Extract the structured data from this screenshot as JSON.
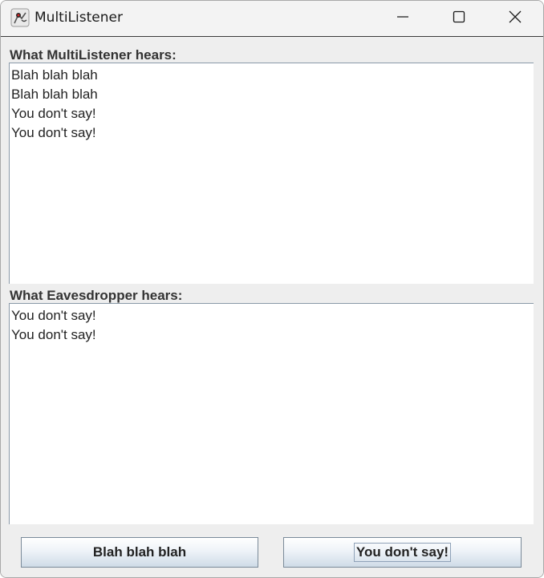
{
  "window": {
    "title": "MultiListener",
    "icon": "java-duke-icon"
  },
  "titlebar_controls": {
    "minimize": "minimize-icon",
    "maximize": "maximize-icon",
    "close": "close-icon"
  },
  "multilistener": {
    "label": "What MultiListener hears:",
    "lines": [
      "Blah blah blah",
      "Blah blah blah",
      "You don't say!",
      "You don't say!"
    ]
  },
  "eavesdropper": {
    "label": "What Eavesdropper hears:",
    "lines": [
      "You don't say!",
      "You don't say!"
    ]
  },
  "buttons": {
    "blah_label": "Blah blah blah",
    "say_label": "You don't say!"
  },
  "colors": {
    "window_bg": "#eeeeee",
    "text_area_bg": "#ffffff",
    "button_gradient_bottom": "#cfdbe7"
  }
}
